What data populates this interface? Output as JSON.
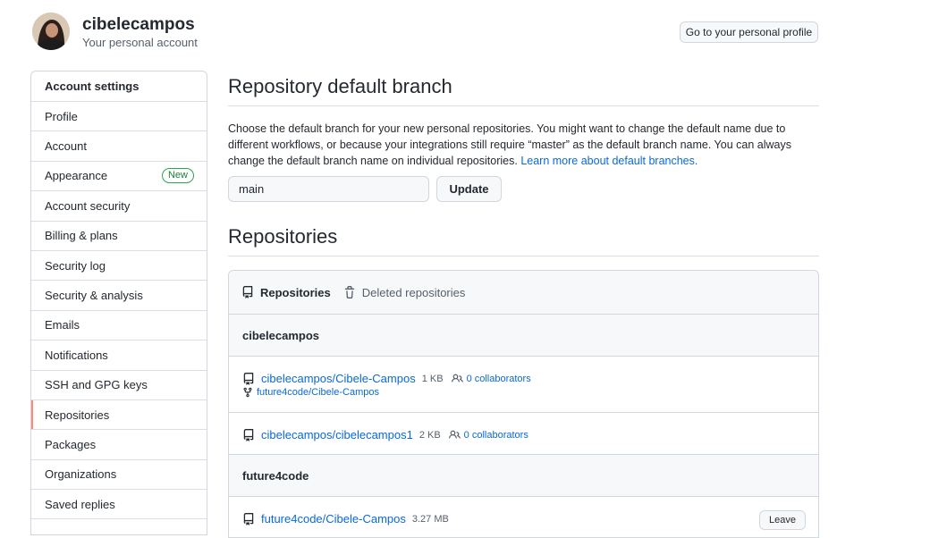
{
  "header": {
    "username": "cibelecampos",
    "subtitle": "Your personal account",
    "profile_button": "Go to your personal profile"
  },
  "sidebar": {
    "heading": "Account settings",
    "items": [
      {
        "label": "Profile"
      },
      {
        "label": "Account"
      },
      {
        "label": "Appearance",
        "badge": "New"
      },
      {
        "label": "Account security"
      },
      {
        "label": "Billing & plans"
      },
      {
        "label": "Security log"
      },
      {
        "label": "Security & analysis"
      },
      {
        "label": "Emails"
      },
      {
        "label": "Notifications"
      },
      {
        "label": "SSH and GPG keys"
      },
      {
        "label": "Repositories",
        "selected": true
      },
      {
        "label": "Packages"
      },
      {
        "label": "Organizations"
      },
      {
        "label": "Saved replies"
      }
    ]
  },
  "default_branch": {
    "title": "Repository default branch",
    "description": "Choose the default branch for your new personal repositories. You might want to change the default name due to different workflows, or because your integrations still require “master” as the default branch name. You can always change the default branch name on individual repositories.",
    "learn_more": "Learn more about default branches.",
    "input_value": "main",
    "update_button": "Update"
  },
  "repositories": {
    "title": "Repositories",
    "tabs": [
      {
        "label": "Repositories",
        "icon": "repo-icon"
      },
      {
        "label": "Deleted repositories",
        "icon": "trash-icon"
      }
    ],
    "groups": [
      {
        "owner": "cibelecampos",
        "repos": [
          {
            "name": "cibelecampos/Cibele-Campos",
            "size": "1 KB",
            "collaborators": "0 collaborators",
            "fork_of": "future4code/Cibele-Campos"
          },
          {
            "name": "cibelecampos/cibelecampos1",
            "size": "2 KB",
            "collaborators": "0 collaborators"
          }
        ]
      },
      {
        "owner": "future4code",
        "repos": [
          {
            "name": "future4code/Cibele-Campos",
            "size": "3.27 MB",
            "leave_button": "Leave"
          }
        ]
      }
    ]
  },
  "colors": {
    "link": "#0969da",
    "selected_marker": "#fd8c73",
    "badge_green": "#1a7f37"
  }
}
